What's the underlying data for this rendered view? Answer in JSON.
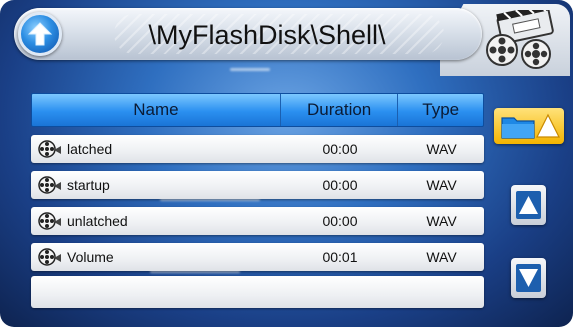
{
  "titlebar": {
    "path": "\\MyFlashDisk\\Shell\\",
    "up_icon": "up-arrow-icon",
    "camera_icon": "camera-film-icon"
  },
  "table": {
    "columns": [
      "Name",
      "Duration",
      "Type"
    ],
    "rows": [
      {
        "name": "latched",
        "duration": "00:00",
        "type": "WAV"
      },
      {
        "name": "startup",
        "duration": "00:00",
        "type": "WAV"
      },
      {
        "name": "unlatched",
        "duration": "00:00",
        "type": "WAV"
      },
      {
        "name": "Volume",
        "duration": "00:01",
        "type": "WAV"
      }
    ],
    "row_icon": "film-reel-icon"
  },
  "side": {
    "folder_icon": "folder-up-icon",
    "scroll_up_icon": "triangle-up-icon",
    "scroll_down_icon": "triangle-down-icon"
  },
  "colors": {
    "background": "#2f6fc0",
    "header": "#2a8ff0",
    "accent": "#f4b400"
  }
}
